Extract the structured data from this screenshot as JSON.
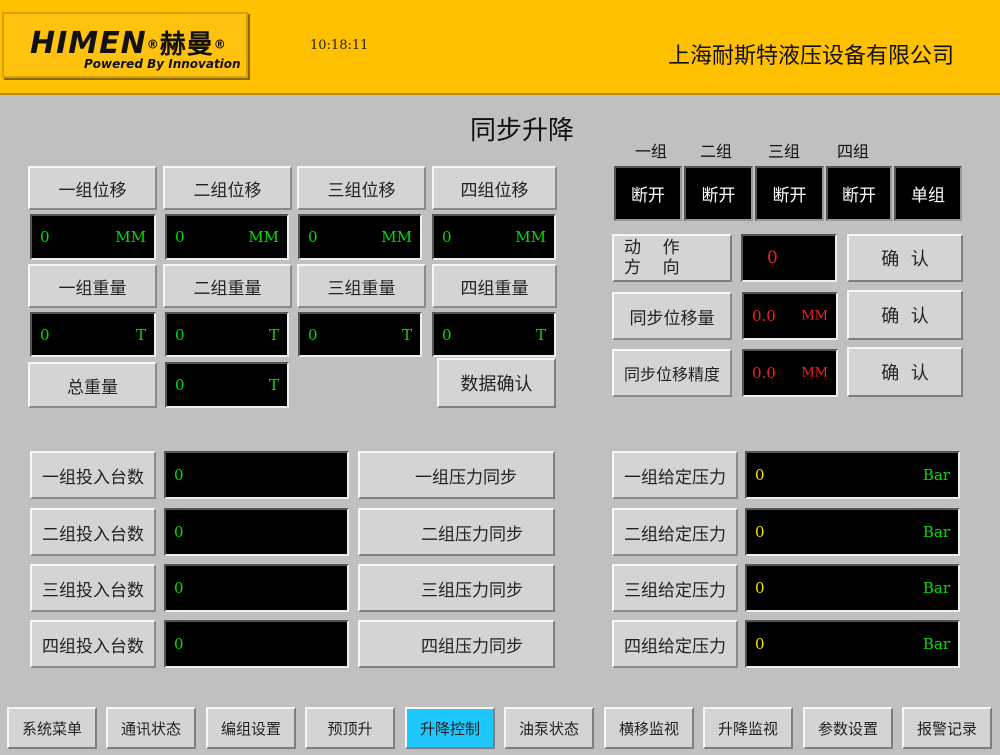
{
  "header": {
    "logo_text": "HIMEN",
    "logo_cn": "赫曼",
    "logo_reg": "®",
    "logo_tagline": "Powered By Innovation",
    "clock": "10:18:11",
    "company": "上海耐斯特液压设备有限公司"
  },
  "page_title": "同步升降",
  "displacement": [
    {
      "label": "一组位移",
      "value": "0",
      "unit": "MM"
    },
    {
      "label": "二组位移",
      "value": "0",
      "unit": "MM"
    },
    {
      "label": "三组位移",
      "value": "0",
      "unit": "MM"
    },
    {
      "label": "四组位移",
      "value": "0",
      "unit": "MM"
    }
  ],
  "weight": [
    {
      "label": "一组重量",
      "value": "0",
      "unit": "T"
    },
    {
      "label": "二组重量",
      "value": "0",
      "unit": "T"
    },
    {
      "label": "三组重量",
      "value": "0",
      "unit": "T"
    },
    {
      "label": "四组重量",
      "value": "0",
      "unit": "T"
    }
  ],
  "total_weight": {
    "label": "总重量",
    "value": "0",
    "unit": "T"
  },
  "data_confirm_label": "数据确认",
  "groups": {
    "headers": [
      "一组",
      "二组",
      "三组",
      "四组"
    ],
    "states": [
      "断开",
      "断开",
      "断开",
      "断开"
    ],
    "mode": "单组"
  },
  "controls": {
    "direction_label_line1": "动    作",
    "direction_label_line2": "方    向",
    "direction_value": "0",
    "sync_disp_label": "同步位移量",
    "sync_disp_value": "0.0",
    "sync_disp_unit": "MM",
    "sync_prec_label": "同步位移精度",
    "sync_prec_value": "0.0",
    "sync_prec_unit": "MM",
    "confirm_label": "确  认"
  },
  "input_counts": [
    {
      "label": "一组投入台数",
      "value": "0",
      "sync_label": "一组压力同步"
    },
    {
      "label": "二组投入台数",
      "value": "0",
      "sync_label": "二组压力同步"
    },
    {
      "label": "三组投入台数",
      "value": "0",
      "sync_label": "三组压力同步"
    },
    {
      "label": "四组投入台数",
      "value": "0",
      "sync_label": "四组压力同步"
    }
  ],
  "pressure": [
    {
      "label": "一组给定压力",
      "value": "0",
      "unit": "Bar"
    },
    {
      "label": "二组给定压力",
      "value": "0",
      "unit": "Bar"
    },
    {
      "label": "三组给定压力",
      "value": "0",
      "unit": "Bar"
    },
    {
      "label": "四组给定压力",
      "value": "0",
      "unit": "Bar"
    }
  ],
  "nav": [
    "系统菜单",
    "通讯状态",
    "编组设置",
    "预顶升",
    "升降控制",
    "油泵状态",
    "横移监视",
    "升降监视",
    "参数设置",
    "报警记录"
  ],
  "nav_active": "升降控制",
  "colors": {
    "header_bg": "#ffc000",
    "panel_bg": "#c0c0c0",
    "active_nav": "#1ec8ff",
    "value_green": "#00e000",
    "value_red": "#ff1e1e",
    "value_yellow": "#ffe000"
  }
}
